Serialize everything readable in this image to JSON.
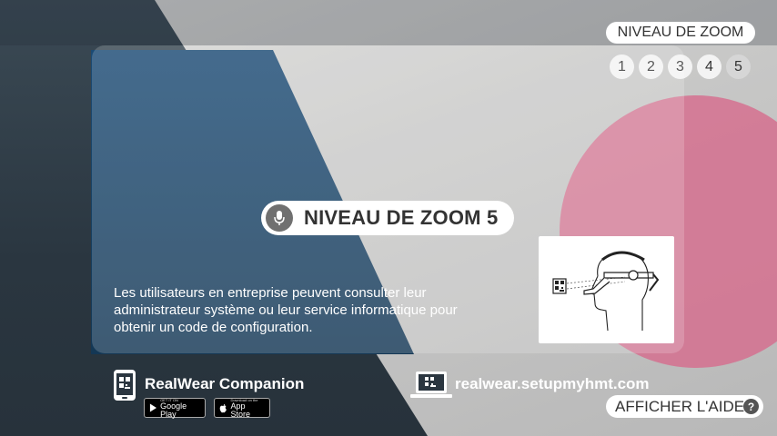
{
  "zoom_selector": {
    "label": "NIVEAU DE ZOOM",
    "levels": [
      "1",
      "2",
      "3",
      "4",
      "5"
    ],
    "selected": "5"
  },
  "zoom_indicator": {
    "text": "NIVEAU DE ZOOM 5",
    "icon": "microphone-icon"
  },
  "instructions": {
    "text": "Les utilisateurs en entreprise peuvent consulter leur administrateur système ou leur service informatique pour obtenir un code de configuration."
  },
  "companion": {
    "title": "RealWear Companion",
    "google_play_small": "GET IT ON",
    "google_play_big": "Google Play",
    "app_store_small": "Download on the",
    "app_store_big": "App Store"
  },
  "website": {
    "url": "realwear.setupmyhmt.com"
  },
  "help": {
    "label": "AFFICHER L'AIDE",
    "icon_text": "?"
  },
  "colors": {
    "pill_background": "#ffffff",
    "text_dark": "#333333",
    "panel_overlay": "rgba(255,255,255,0.18)"
  }
}
